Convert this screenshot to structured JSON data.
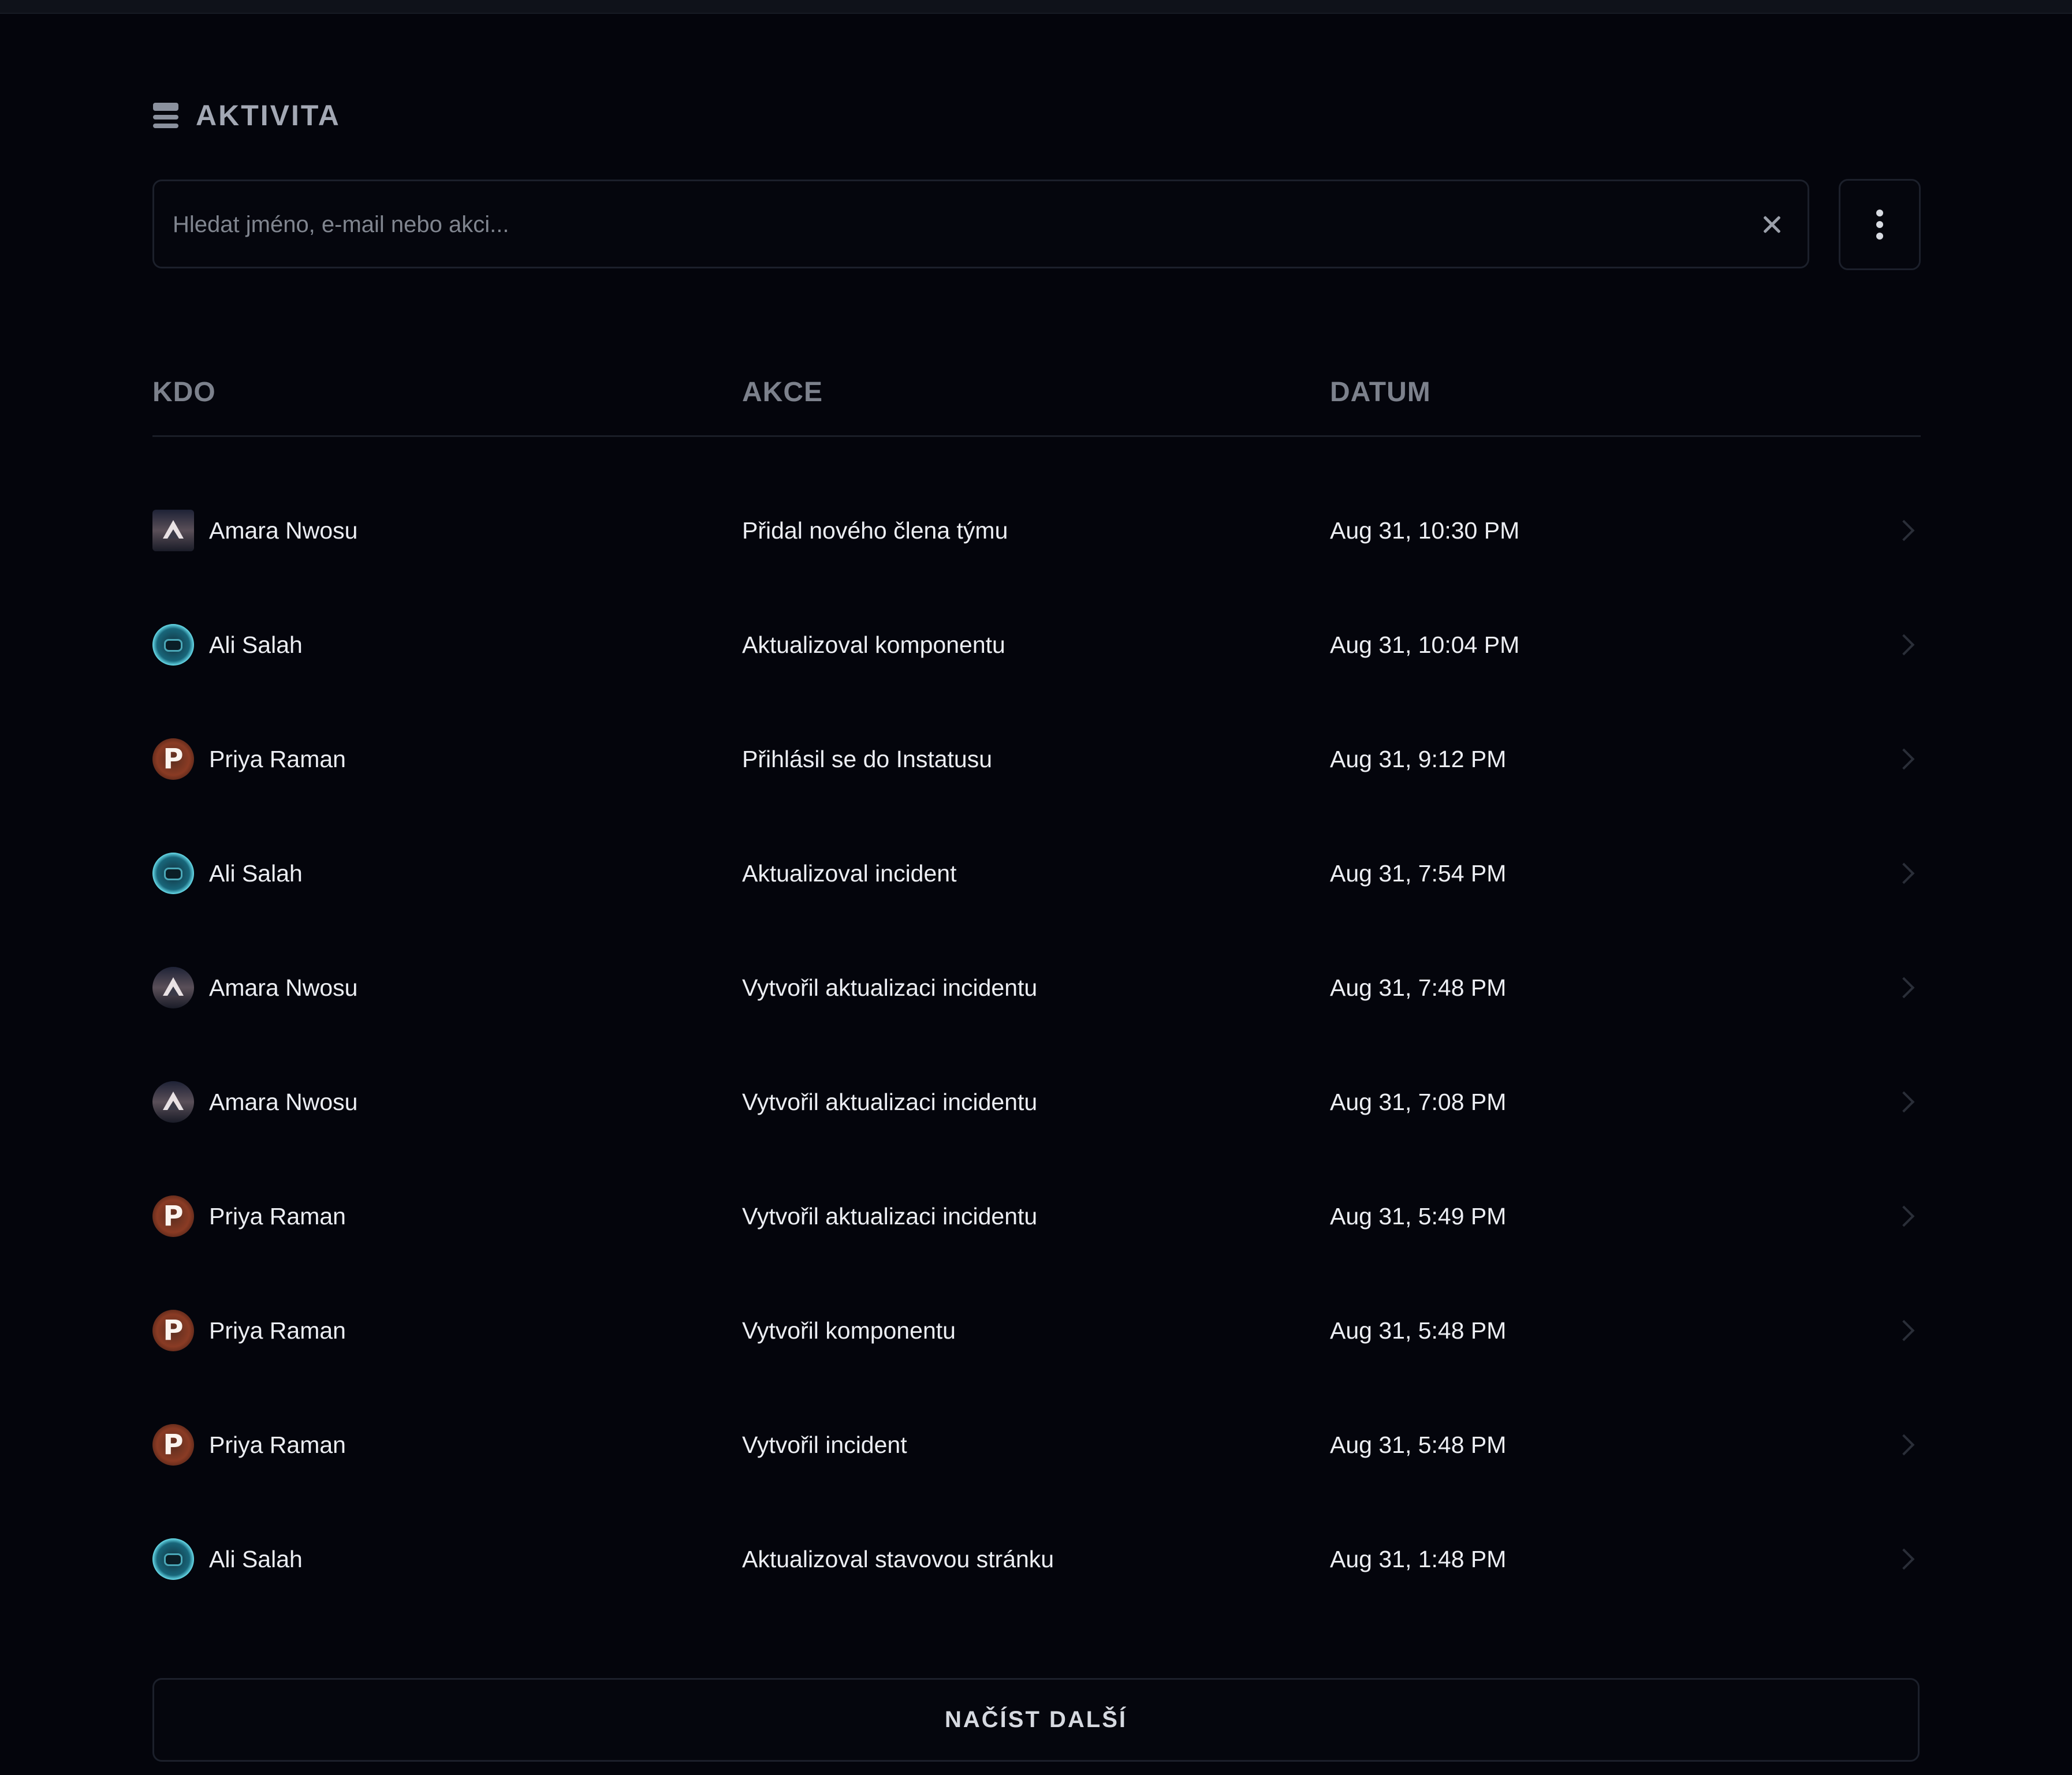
{
  "page": {
    "title": "AKTIVITA",
    "title_icon": "activity-list-icon"
  },
  "search": {
    "placeholder": "Hledat jméno, e-mail nebo akci...",
    "value": "",
    "clear_icon": "close-icon",
    "menu_icon": "more-vertical-icon"
  },
  "table": {
    "columns": [
      "KDO",
      "AKCE",
      "DATUM"
    ],
    "rows": [
      {
        "who": "Amara Nwosu",
        "avatar": "triangle-avatar",
        "action": "Přidal nového člena týmu",
        "date": "Aug 31, 10:30 PM"
      },
      {
        "who": "Ali Salah",
        "avatar": "cyan-avatar",
        "action": "Aktualizoval komponentu",
        "date": "Aug 31, 10:04 PM"
      },
      {
        "who": "Priya Raman",
        "avatar": "p-avatar",
        "action": "Přihlásil se do Instatusu",
        "date": "Aug 31, 9:12 PM"
      },
      {
        "who": "Ali Salah",
        "avatar": "cyan-avatar",
        "action": "Aktualizoval incident",
        "date": "Aug 31, 7:54 PM"
      },
      {
        "who": "Amara Nwosu",
        "avatar": "triangle-avatar",
        "action": "Vytvořil aktualizaci incidentu",
        "date": "Aug 31, 7:48 PM"
      },
      {
        "who": "Amara Nwosu",
        "avatar": "triangle-avatar",
        "action": "Vytvořil aktualizaci incidentu",
        "date": "Aug 31, 7:08 PM"
      },
      {
        "who": "Priya Raman",
        "avatar": "p-avatar",
        "action": "Vytvořil aktualizaci incidentu",
        "date": "Aug 31, 5:49 PM"
      },
      {
        "who": "Priya Raman",
        "avatar": "p-avatar",
        "action": "Vytvořil komponentu",
        "date": "Aug 31, 5:48 PM"
      },
      {
        "who": "Priya Raman",
        "avatar": "p-avatar",
        "action": "Vytvořil incident",
        "date": "Aug 31, 5:48 PM"
      },
      {
        "who": "Ali Salah",
        "avatar": "cyan-avatar",
        "action": "Aktualizoval stavovou stránku",
        "date": "Aug 31, 1:48 PM"
      }
    ]
  },
  "load_more": {
    "label": "NAČÍST DALŠÍ"
  },
  "colors": {
    "background": "#04050c",
    "text": "#eceef3",
    "muted": "#7c818c",
    "border": "#1c202b"
  }
}
